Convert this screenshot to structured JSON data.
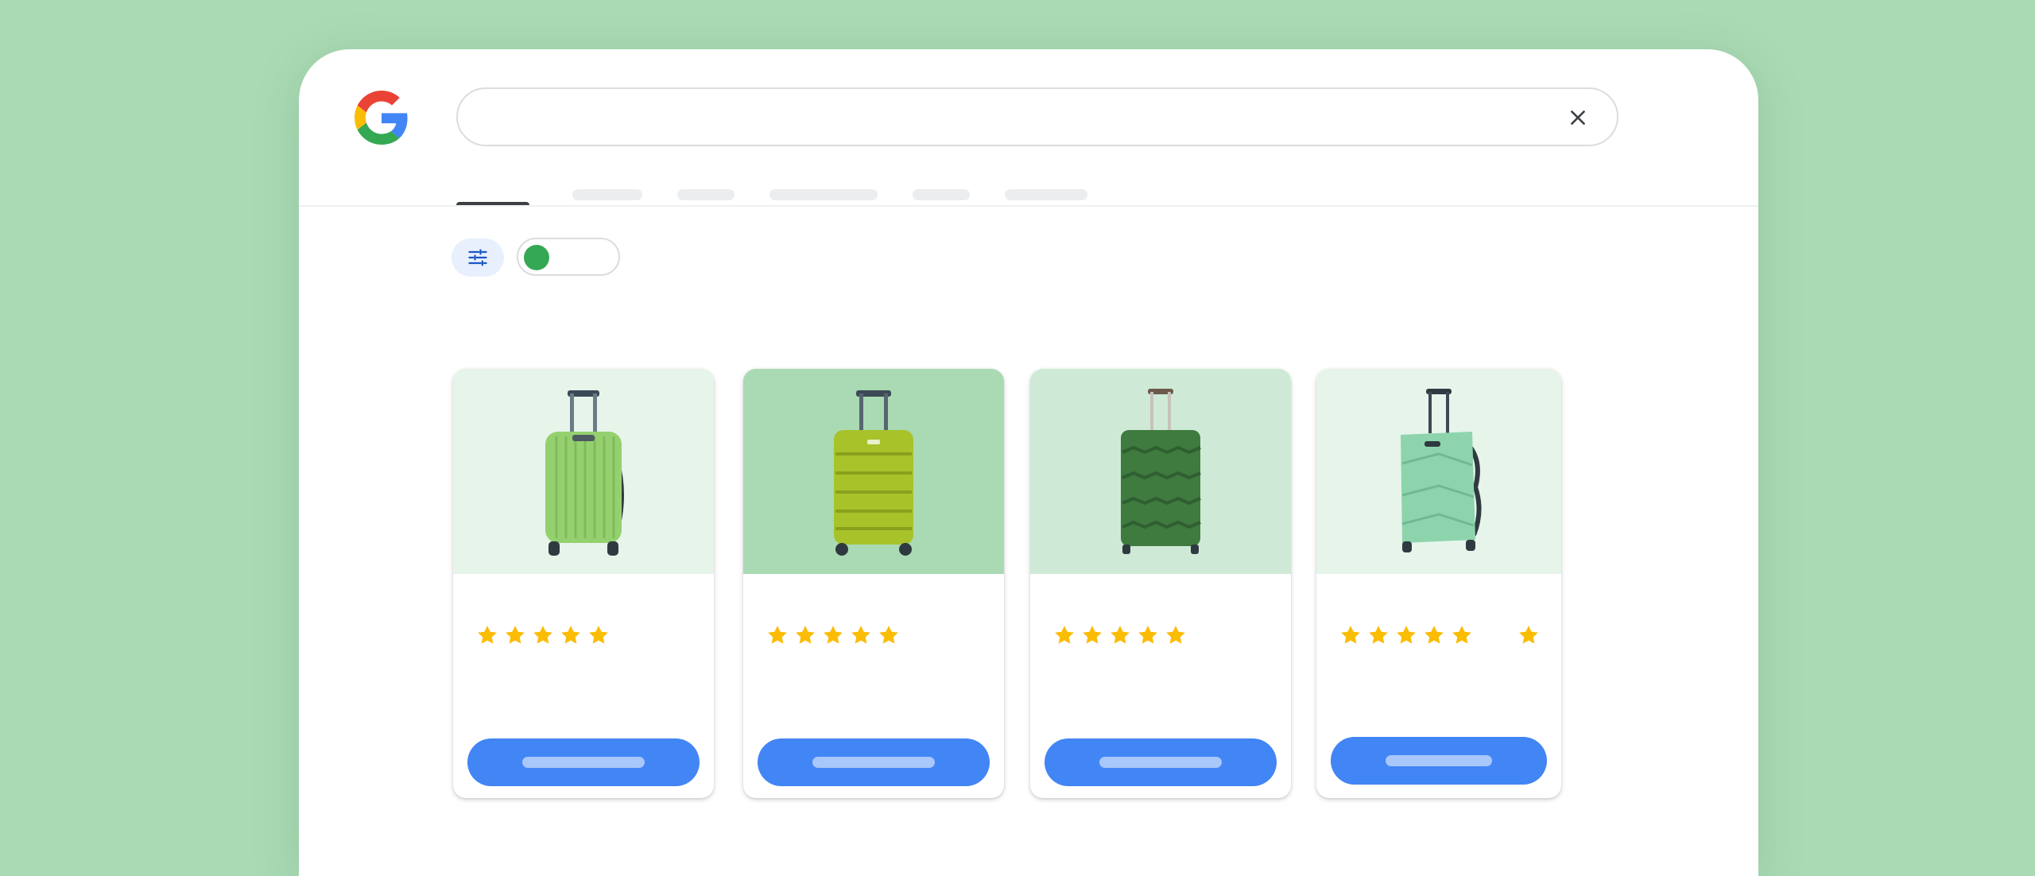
{
  "search": {
    "query": "",
    "placeholder": ""
  },
  "header": {
    "logo": "google-g-logo",
    "clear_icon": "close-icon"
  },
  "tabs": [
    {
      "label": "",
      "active": true
    },
    {
      "label": "",
      "active": false
    },
    {
      "label": "",
      "active": false
    },
    {
      "label": "",
      "active": false
    },
    {
      "label": "",
      "active": false
    },
    {
      "label": "",
      "active": false
    }
  ],
  "filters": {
    "tune_icon": "tune-sliders-icon",
    "toggle_on": true
  },
  "colors": {
    "background": "#a9dab4",
    "accent": "#4285f4",
    "toggle": "#34a853",
    "star": "#fbbc04"
  },
  "products": [
    {
      "image": "light-green-ribbed-suitcase",
      "image_bg": "#e6f4ea",
      "rating_stars": 5,
      "button_label": ""
    },
    {
      "image": "lime-hardshell-suitcase",
      "image_bg": "#a9dab4",
      "rating_stars": 5,
      "button_label": ""
    },
    {
      "image": "dark-green-hardshell-suitcase",
      "image_bg": "#ceead6",
      "rating_stars": 5,
      "button_label": ""
    },
    {
      "image": "mint-hardshell-suitcase",
      "image_bg": "#e6f4ea",
      "rating_stars": 6,
      "button_label": ""
    }
  ]
}
